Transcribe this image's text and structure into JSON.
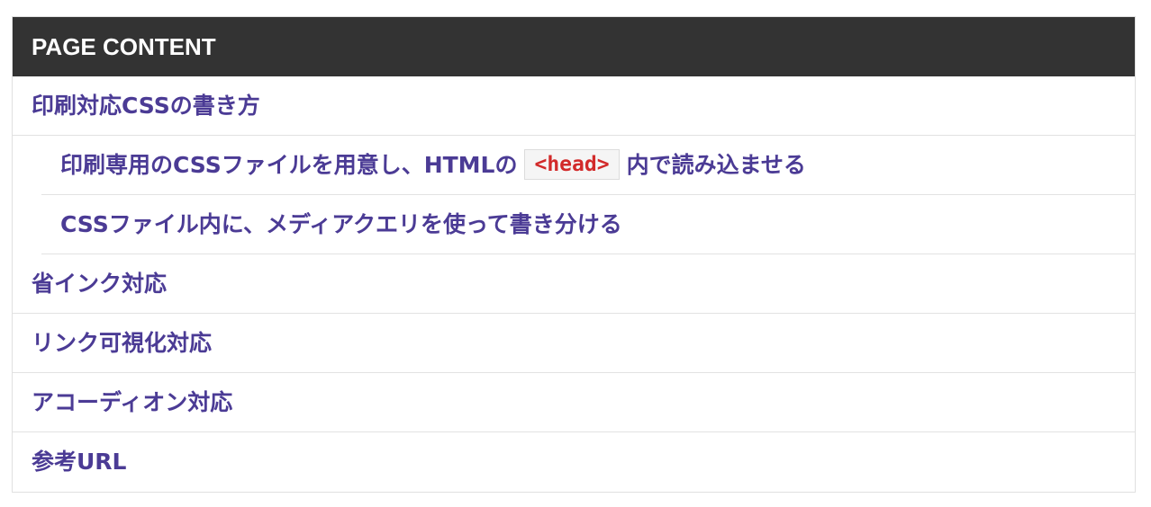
{
  "toc": {
    "header": "PAGE CONTENT",
    "items": [
      {
        "label": "印刷対応CSSの書き方",
        "level": 1
      },
      {
        "label_before": "印刷専用のCSSファイルを用意し、HTMLの",
        "code": "<head>",
        "label_after": "内で読み込ませる",
        "level": 2
      },
      {
        "label": "CSSファイル内に、メディアクエリを使って書き分ける",
        "level": 2
      },
      {
        "label": "省インク対応",
        "level": 1
      },
      {
        "label": "リンク可視化対応",
        "level": 1
      },
      {
        "label": "アコーディオン対応",
        "level": 1
      },
      {
        "label": "参考URL",
        "level": 1
      }
    ]
  },
  "colors": {
    "header_bg": "#333333",
    "header_text": "#ffffff",
    "link": "#4b3b95",
    "code_text": "#d22a2a",
    "code_bg": "#f5f5f5",
    "divider": "#e2e2e2"
  }
}
